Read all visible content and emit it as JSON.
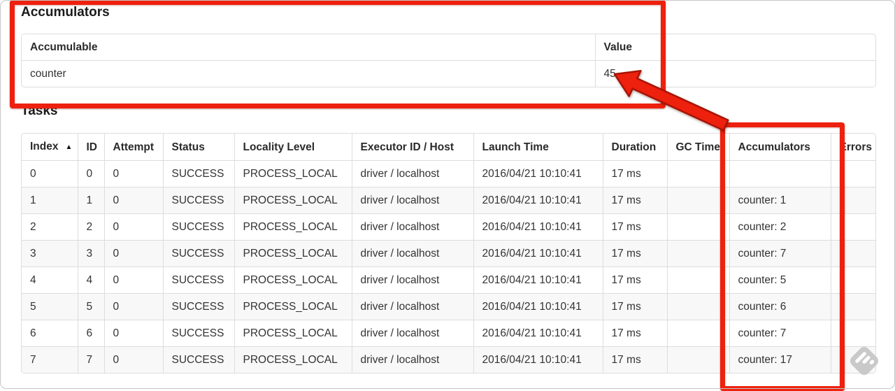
{
  "accumulators": {
    "title": "Accumulators",
    "headers": [
      "Accumulable",
      "Value"
    ],
    "rows": [
      {
        "name": "counter",
        "value": "45"
      }
    ]
  },
  "tasks": {
    "title": "Tasks",
    "sort_indicator": "▲",
    "headers": [
      "Index",
      "ID",
      "Attempt",
      "Status",
      "Locality Level",
      "Executor ID / Host",
      "Launch Time",
      "Duration",
      "GC Time",
      "Accumulators",
      "Errors"
    ],
    "rows": [
      {
        "index": "0",
        "id": "0",
        "attempt": "0",
        "status": "SUCCESS",
        "locality_level": "PROCESS_LOCAL",
        "executor_id_host": "driver / localhost",
        "launch_time": "2016/04/21 10:10:41",
        "duration": "17 ms",
        "gc_time": "",
        "accumulators": "",
        "errors": ""
      },
      {
        "index": "1",
        "id": "1",
        "attempt": "0",
        "status": "SUCCESS",
        "locality_level": "PROCESS_LOCAL",
        "executor_id_host": "driver / localhost",
        "launch_time": "2016/04/21 10:10:41",
        "duration": "17 ms",
        "gc_time": "",
        "accumulators": "counter: 1",
        "errors": ""
      },
      {
        "index": "2",
        "id": "2",
        "attempt": "0",
        "status": "SUCCESS",
        "locality_level": "PROCESS_LOCAL",
        "executor_id_host": "driver / localhost",
        "launch_time": "2016/04/21 10:10:41",
        "duration": "17 ms",
        "gc_time": "",
        "accumulators": "counter: 2",
        "errors": ""
      },
      {
        "index": "3",
        "id": "3",
        "attempt": "0",
        "status": "SUCCESS",
        "locality_level": "PROCESS_LOCAL",
        "executor_id_host": "driver / localhost",
        "launch_time": "2016/04/21 10:10:41",
        "duration": "17 ms",
        "gc_time": "",
        "accumulators": "counter: 7",
        "errors": ""
      },
      {
        "index": "4",
        "id": "4",
        "attempt": "0",
        "status": "SUCCESS",
        "locality_level": "PROCESS_LOCAL",
        "executor_id_host": "driver / localhost",
        "launch_time": "2016/04/21 10:10:41",
        "duration": "17 ms",
        "gc_time": "",
        "accumulators": "counter: 5",
        "errors": ""
      },
      {
        "index": "5",
        "id": "5",
        "attempt": "0",
        "status": "SUCCESS",
        "locality_level": "PROCESS_LOCAL",
        "executor_id_host": "driver / localhost",
        "launch_time": "2016/04/21 10:10:41",
        "duration": "17 ms",
        "gc_time": "",
        "accumulators": "counter: 6",
        "errors": ""
      },
      {
        "index": "6",
        "id": "6",
        "attempt": "0",
        "status": "SUCCESS",
        "locality_level": "PROCESS_LOCAL",
        "executor_id_host": "driver / localhost",
        "launch_time": "2016/04/21 10:10:41",
        "duration": "17 ms",
        "gc_time": "",
        "accumulators": "counter: 7",
        "errors": ""
      },
      {
        "index": "7",
        "id": "7",
        "attempt": "0",
        "status": "SUCCESS",
        "locality_level": "PROCESS_LOCAL",
        "executor_id_host": "driver / localhost",
        "launch_time": "2016/04/21 10:10:41",
        "duration": "17 ms",
        "gc_time": "",
        "accumulators": "counter: 17",
        "errors": ""
      }
    ]
  },
  "annotations": {
    "highlight_color": "#ee200e",
    "outline_color": "#a81404",
    "watermark_color": "#c9c9c9"
  }
}
